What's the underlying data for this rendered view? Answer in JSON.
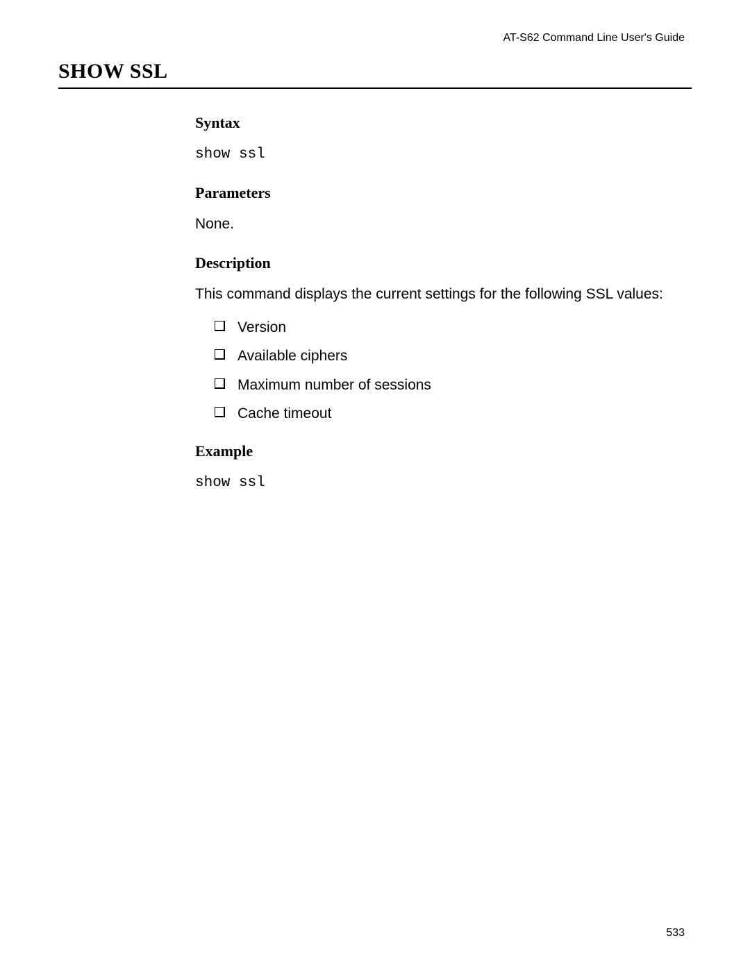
{
  "header": "AT-S62 Command Line User's Guide",
  "page_number": "533",
  "title": "SHOW SSL",
  "sections": {
    "syntax": {
      "heading": "Syntax",
      "body": "show ssl"
    },
    "parameters": {
      "heading": "Parameters",
      "body": "None."
    },
    "description": {
      "heading": "Description",
      "body": "This command displays the current settings for the following SSL values:",
      "items": [
        "Version",
        "Available ciphers",
        "Maximum number of sessions",
        "Cache timeout"
      ]
    },
    "example": {
      "heading": "Example",
      "body": "show ssl"
    }
  }
}
